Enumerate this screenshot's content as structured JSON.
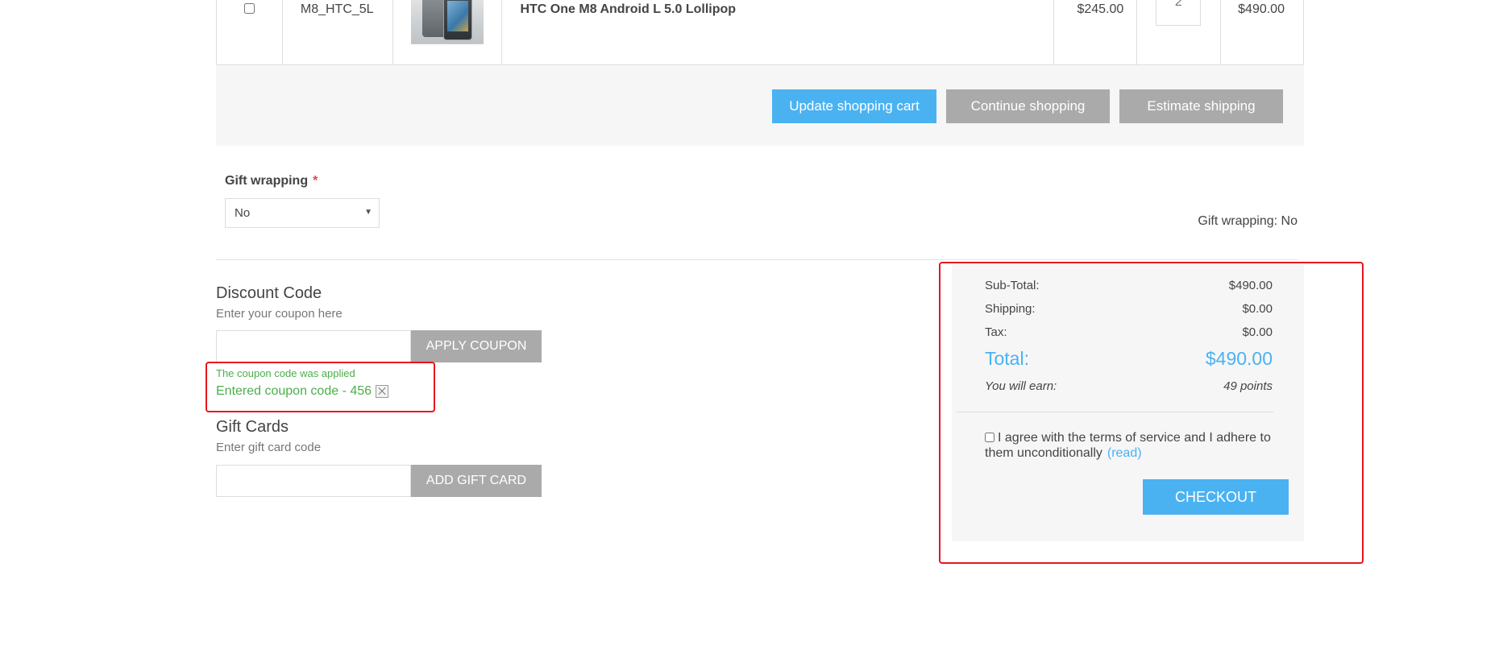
{
  "cart": {
    "row": {
      "sku": "M8_HTC_5L",
      "product_name": "HTC One M8 Android L 5.0 Lollipop",
      "unit_price": "$245.00",
      "quantity": "2",
      "total": "$490.00"
    },
    "buttons": {
      "update": "Update shopping cart",
      "continue": "Continue shopping",
      "estimate": "Estimate shipping"
    }
  },
  "gift_wrapping": {
    "label": "Gift wrapping",
    "required_mark": "*",
    "selected": "No",
    "summary": "Gift wrapping: No"
  },
  "discount": {
    "title": "Discount Code",
    "hint": "Enter your coupon here",
    "input_value": "",
    "apply_button": "APPLY COUPON",
    "applied_message": "The coupon code was applied",
    "entered_code": "Entered coupon code - 456"
  },
  "gift_cards": {
    "title": "Gift Cards",
    "hint": "Enter gift card code",
    "input_value": "",
    "add_button": "ADD GIFT CARD"
  },
  "totals": {
    "subtotal_label": "Sub-Total:",
    "subtotal_value": "$490.00",
    "shipping_label": "Shipping:",
    "shipping_value": "$0.00",
    "tax_label": "Tax:",
    "tax_value": "$0.00",
    "total_label": "Total:",
    "total_value": "$490.00",
    "earn_label": "You will earn:",
    "earn_value": "49 points",
    "terms_text": "I agree with the terms of service and I adhere to them unconditionally",
    "terms_link": "(read)",
    "checkout_button": "CHECKOUT"
  },
  "colors": {
    "accent_blue": "#4ab2f1",
    "button_gray": "#aaaaaa",
    "success_green": "#4cae4c",
    "highlight_red": "#e8141e",
    "panel_bg": "#f6f6f6"
  }
}
